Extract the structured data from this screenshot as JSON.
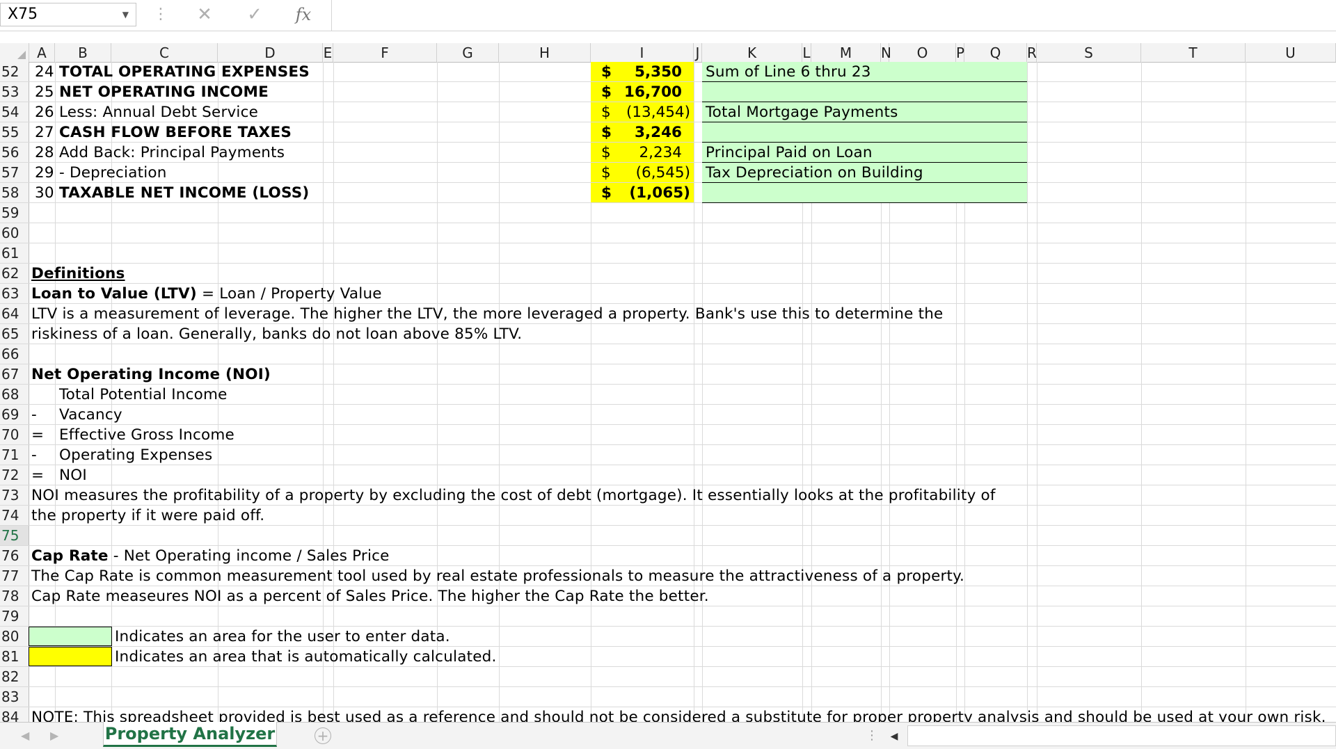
{
  "formula_bar": {
    "name_box": "X75",
    "cancel_icon": "close-icon",
    "enter_icon": "check-icon",
    "fx_label": "fx",
    "formula": ""
  },
  "columns": [
    "A",
    "B",
    "C",
    "D",
    "E",
    "F",
    "G",
    "H",
    "I",
    "J",
    "K",
    "L",
    "M",
    "N",
    "O",
    "P",
    "Q",
    "R",
    "S",
    "T",
    "U"
  ],
  "rows": {
    "r52": {
      "num": "52",
      "b": "24",
      "c": "TOTAL OPERATING EXPENSES",
      "i_dollar": "$",
      "i_val": "5,350",
      "k": "Sum of Line 6 thru 23"
    },
    "r53": {
      "num": "53",
      "b": "25",
      "c": "NET OPERATING INCOME",
      "i_dollar": "$",
      "i_val": "16,700",
      "k": ""
    },
    "r54": {
      "num": "54",
      "b": "26",
      "c": "Less: Annual Debt Service",
      "i_dollar": "$",
      "i_val": "(13,454)",
      "k": "Total Mortgage Payments"
    },
    "r55": {
      "num": "55",
      "b": "27",
      "c": "CASH FLOW BEFORE TAXES",
      "i_dollar": "$",
      "i_val": "3,246",
      "k": ""
    },
    "r56": {
      "num": "56",
      "b": "28",
      "c": "Add Back:  Principal Payments",
      "i_dollar": "$",
      "i_val": "2,234",
      "k": "Principal Paid on Loan"
    },
    "r57": {
      "num": "57",
      "b": "29",
      "c": "- Depreciation",
      "i_dollar": "$",
      "i_val": "(6,545)",
      "k": "Tax Depreciation on Building"
    },
    "r58": {
      "num": "58",
      "b": "30",
      "c": "TAXABLE NET INCOME (LOSS)",
      "i_dollar": "$",
      "i_val": "(1,065)",
      "k": ""
    },
    "r59": {
      "num": "59"
    },
    "r60": {
      "num": "60"
    },
    "r61": {
      "num": "61"
    },
    "r62": {
      "num": "62",
      "a": "Definitions"
    },
    "r63": {
      "num": "63",
      "a_bold": "Loan to Value (LTV)",
      "a_rest": " = Loan / Property Value"
    },
    "r64": {
      "num": "64",
      "a": "LTV is a measurement of leverage.  The higher the LTV, the more leveraged a property.  Bank's use this to determine the"
    },
    "r65": {
      "num": "65",
      "a": "riskiness of a loan.  Generally, banks do not loan above 85% LTV."
    },
    "r66": {
      "num": "66"
    },
    "r67": {
      "num": "67",
      "a": "Net Operating Income (NOI)"
    },
    "r68": {
      "num": "68",
      "a": "",
      "c": "Total Potential Income"
    },
    "r69": {
      "num": "69",
      "a": "-",
      "c": "Vacancy"
    },
    "r70": {
      "num": "70",
      "a": "=",
      "c": "Effective Gross Income"
    },
    "r71": {
      "num": "71",
      "a": "-",
      "c": "Operating Expenses"
    },
    "r72": {
      "num": "72",
      "a": "=",
      "c": "NOI"
    },
    "r73": {
      "num": "73",
      "a": "NOI measures the profitability of a property by excluding the cost of debt (mortgage).  It essentially looks at the profitability of"
    },
    "r74": {
      "num": "74",
      "a": "the property if it were paid off."
    },
    "r75": {
      "num": "75"
    },
    "r76": {
      "num": "76",
      "a_bold": "Cap Rate",
      "a_rest": " - Net Operating income / Sales Price"
    },
    "r77": {
      "num": "77",
      "a": "The Cap Rate is common measurement tool used by real estate professionals to measure the attractiveness of a property."
    },
    "r78": {
      "num": "78",
      "a": "Cap Rate measeures NOI as a percent of Sales Price.  The higher the Cap Rate the better."
    },
    "r79": {
      "num": "79"
    },
    "r80": {
      "num": "80",
      "c": "Indicates an area for the user to enter data."
    },
    "r81": {
      "num": "81",
      "c": "Indicates an area that is automatically calculated."
    },
    "r82": {
      "num": "82"
    },
    "r83": {
      "num": "83"
    },
    "r84": {
      "num": "84",
      "a": "NOTE: This spreadsheet provided is best used as a reference and should not be considered a substitute for proper property analysis and should be used at your own risk."
    }
  },
  "sheet_tabs": {
    "active": "Property Analyzer",
    "add_icon": "plus-icon"
  },
  "colors": {
    "input_fill": "#ccffcc",
    "calc_fill": "#ffff00",
    "accent": "#217346"
  }
}
